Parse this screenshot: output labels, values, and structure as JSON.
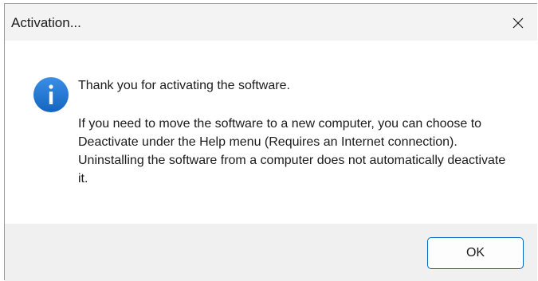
{
  "window": {
    "title": "Activation...",
    "close_icon": "close-icon"
  },
  "message": {
    "icon": "info-icon",
    "line1": "Thank you for activating the software.",
    "body": "If you need to move the software to a new computer, you can choose to Deactivate under the Help menu (Requires an Internet connection). Uninstalling the software from a computer does not automatically deactivate it."
  },
  "buttons": {
    "ok_label": "OK"
  },
  "colors": {
    "accent": "#0067c0",
    "info_icon_fill": "#1e76d3",
    "titlebar_bg": "#f3f3f3",
    "footer_bg": "#f0f0f0"
  }
}
